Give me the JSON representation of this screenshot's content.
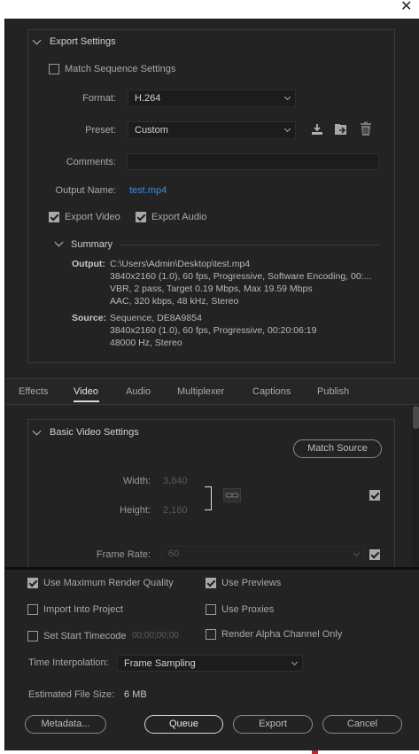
{
  "window": {
    "close_glyph": "✕"
  },
  "export_settings": {
    "title": "Export Settings",
    "match_sequence": {
      "label": "Match Sequence Settings",
      "checked": false
    },
    "format": {
      "label": "Format:",
      "value": "H.264"
    },
    "preset": {
      "label": "Preset:",
      "value": "Custom"
    },
    "comments": {
      "label": "Comments:",
      "value": ""
    },
    "output_name": {
      "label": "Output Name:",
      "value": "test.mp4"
    },
    "export_video": {
      "label": "Export Video",
      "checked": true
    },
    "export_audio": {
      "label": "Export Audio",
      "checked": true
    },
    "preset_icons": [
      "save-preset-icon",
      "import-preset-icon",
      "delete-preset-icon"
    ]
  },
  "summary": {
    "title": "Summary",
    "output_label": "Output:",
    "output_lines": [
      "C:\\Users\\Admin\\Desktop\\test.mp4",
      "3840x2160 (1.0), 60 fps, Progressive, Software Encoding, 00:...",
      "VBR, 2 pass, Target 0.19 Mbps, Max 19.59 Mbps",
      "AAC, 320 kbps, 48 kHz, Stereo"
    ],
    "source_label": "Source:",
    "source_lines": [
      "Sequence, DE8A9854",
      "3840x2160 (1.0), 60 fps, Progressive, 00:20:06:19",
      "48000 Hz, Stereo"
    ]
  },
  "tabs": {
    "items": [
      "Effects",
      "Video",
      "Audio",
      "Multiplexer",
      "Captions",
      "Publish"
    ],
    "active": "Video"
  },
  "basic_video": {
    "title": "Basic Video Settings",
    "match_source_label": "Match Source",
    "width_label": "Width:",
    "width_value": "3,840",
    "height_label": "Height:",
    "height_value": "2,160",
    "frame_rate_label": "Frame Rate:",
    "frame_rate_value": "60"
  },
  "options": {
    "max_render": {
      "label": "Use Maximum Render Quality",
      "checked": true
    },
    "use_previews": {
      "label": "Use Previews",
      "checked": true
    },
    "import_project": {
      "label": "Import Into Project",
      "checked": false
    },
    "use_proxies": {
      "label": "Use Proxies",
      "checked": false
    },
    "start_timecode": {
      "label": "Set Start Timecode",
      "value": "00;00;00;00",
      "checked": false
    },
    "alpha_only": {
      "label": "Render Alpha Channel Only",
      "checked": false
    }
  },
  "time_interpolation": {
    "label": "Time Interpolation:",
    "value": "Frame Sampling"
  },
  "estimated_size": {
    "label": "Estimated File Size:",
    "value": "6 MB"
  },
  "buttons": {
    "metadata": "Metadata...",
    "queue": "Queue",
    "export": "Export",
    "cancel": "Cancel"
  }
}
